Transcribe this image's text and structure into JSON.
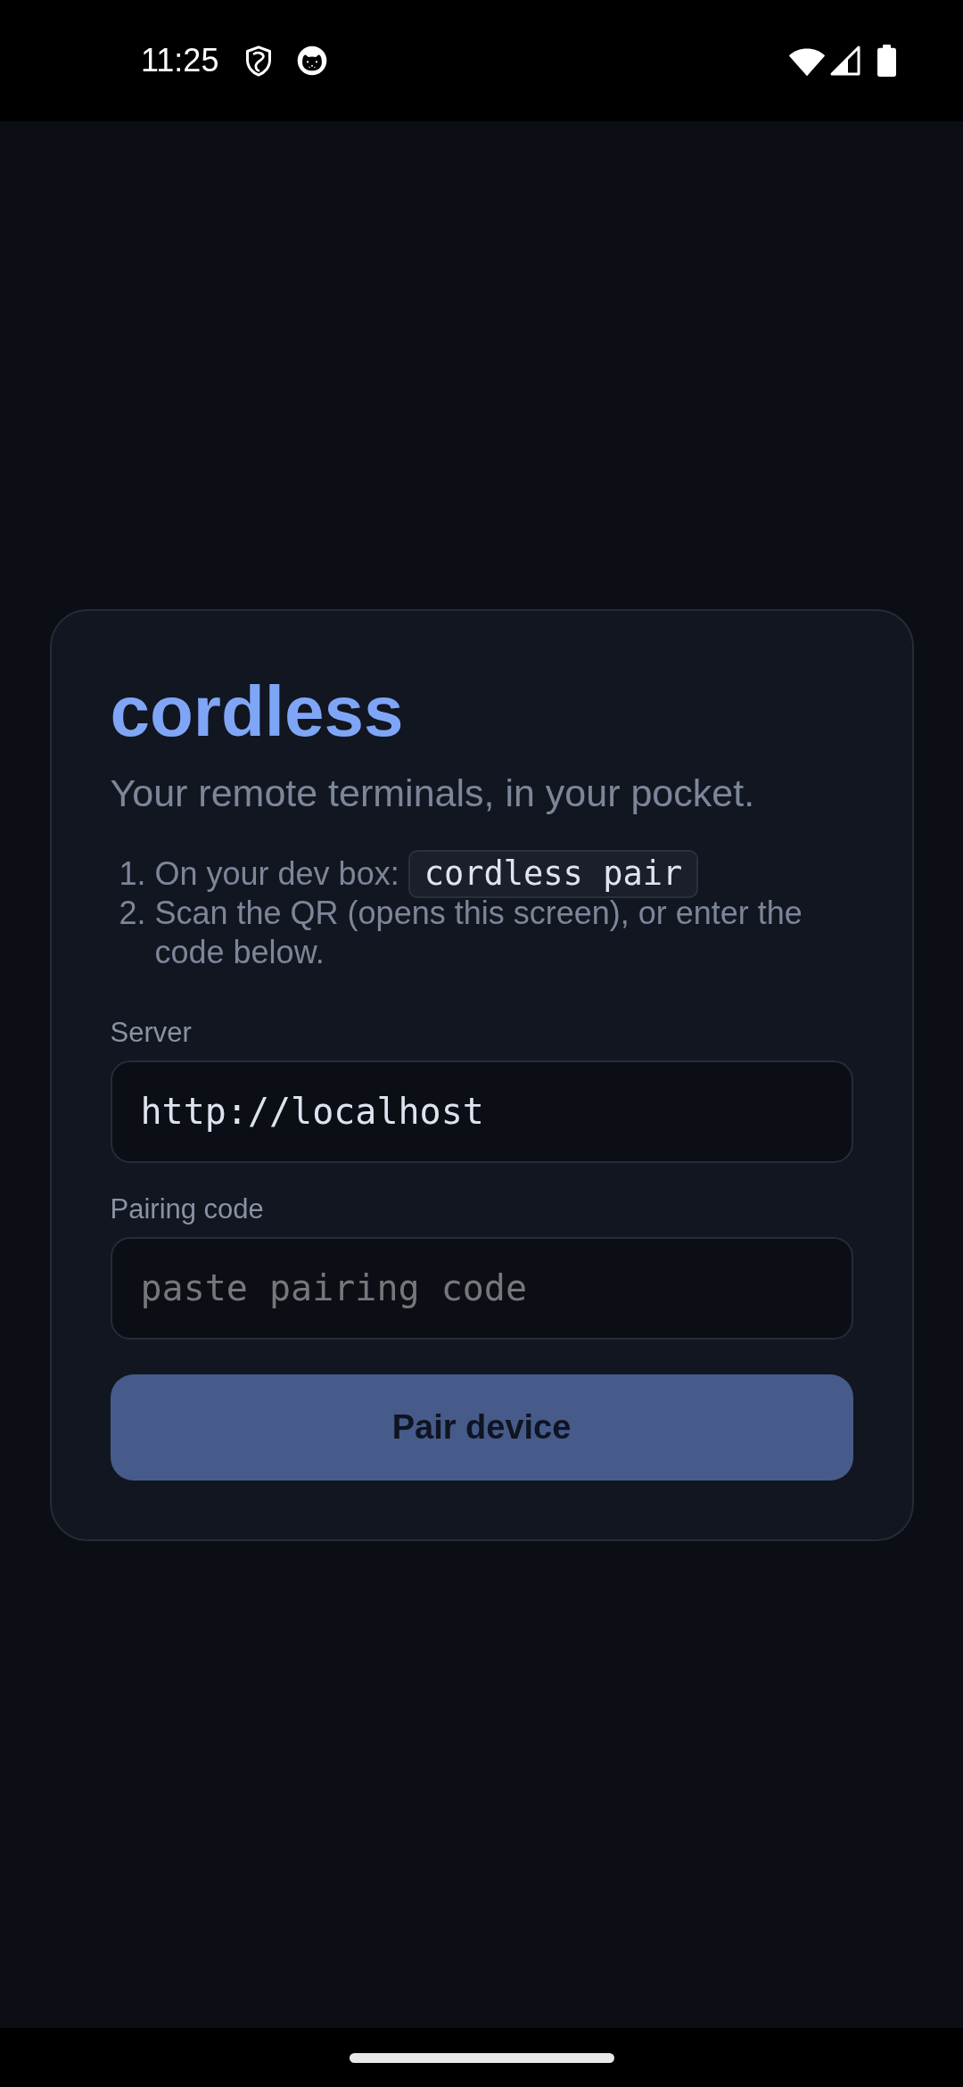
{
  "status_bar": {
    "time": "11:25"
  },
  "card": {
    "title": "cordless",
    "subtitle": "Your remote terminals, in your pocket.",
    "steps": [
      {
        "number": "1.",
        "text": "On your dev box:",
        "code": "cordless pair"
      },
      {
        "number": "2.",
        "text": "Scan the QR (opens this screen), or enter the code below."
      }
    ],
    "fields": [
      {
        "label": "Server",
        "value": "http://localhost"
      },
      {
        "label": "Pairing code",
        "placeholder": "paste pairing code"
      }
    ],
    "button": {
      "label": "Pair device",
      "disabled": true
    }
  }
}
